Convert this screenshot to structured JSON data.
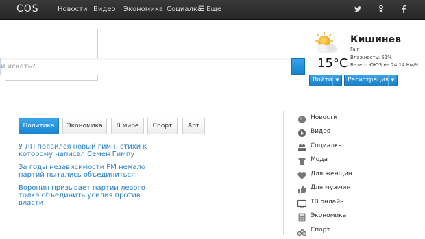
{
  "header": {
    "logo": "COS",
    "nav": [
      "Новости",
      "Видео",
      "Экономика",
      "Социалка",
      "☰ Еще"
    ],
    "social": [
      "twitter-icon",
      "odnoklassniki-icon",
      "facebook-icon"
    ]
  },
  "search": {
    "placeholder": "и искать?"
  },
  "weather": {
    "city": "Кишинев",
    "condition": "Fair",
    "humidity": "Влажность: 51%",
    "wind": "Ветер: ЮЮЗ на 24.14 Км/Ч",
    "temp": "15°C"
  },
  "auth": {
    "login": "Войти",
    "register": "Регистрация"
  },
  "tabs": [
    "Политика",
    "Экономика",
    "В мире",
    "Спорт",
    "Арт"
  ],
  "news": [
    "У ЛП появился новый гимн, стихи к которому написал Семен Гимпу",
    "За годы независимости РМ немало партий пытались объединиться",
    "Воронин призывает партии левого толка объединить усилия против власти"
  ],
  "sidebar": [
    "Новости",
    "Видео",
    "Социалка",
    "Мода",
    "Для женщин",
    "Для мужчин",
    "ТВ онлайн",
    "Экономика",
    "Спорт"
  ],
  "colors": {
    "accent": "#1a86d3",
    "link": "#2a7fc9",
    "topbar": "#2e2e2e"
  }
}
